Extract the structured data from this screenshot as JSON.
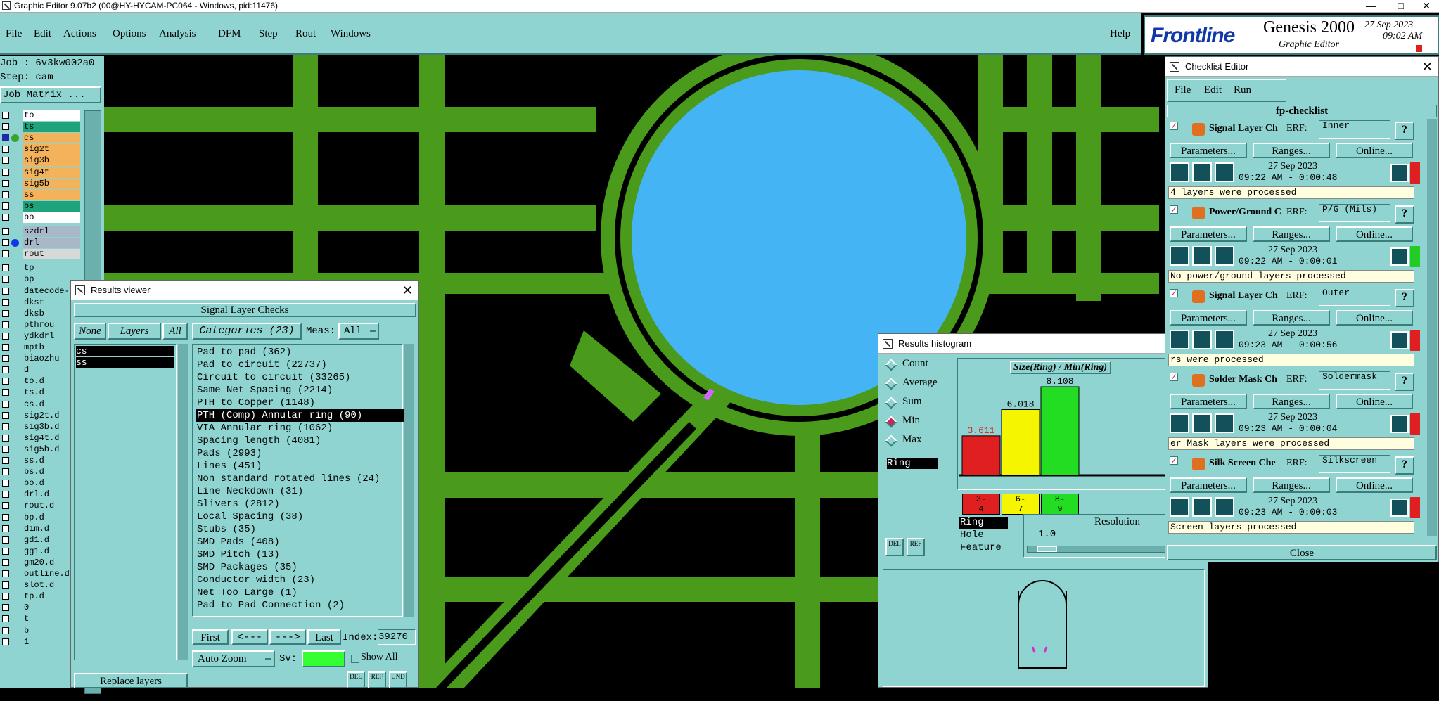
{
  "title_bar": {
    "text": "Graphic Editor 9.07b2 (00@HY-HYCAM-PC064 - Windows, pid:11476)"
  },
  "menu": [
    "File",
    "Edit",
    "Actions",
    "Options",
    "Analysis",
    "DFM",
    "Step",
    "Rout",
    "Windows"
  ],
  "help_label": "Help",
  "branding": {
    "logo": "Frontline",
    "product": "Genesis 2000",
    "subtitle": "Graphic Editor",
    "date": "27 Sep 2023",
    "time": "09:02 AM"
  },
  "job": {
    "job_label": "Job : 6v3kw002a0",
    "step_label": "Step: cam",
    "matrix_button": "Job Matrix ..."
  },
  "layers": [
    {
      "name": "to",
      "color": "#ffffff"
    },
    {
      "name": "ts",
      "color": "#1fa37a"
    },
    {
      "name": "cs",
      "color": "#f4b35a",
      "active": true
    },
    {
      "name": "sig2t",
      "color": "#f4b35a"
    },
    {
      "name": "sig3b",
      "color": "#f4b35a"
    },
    {
      "name": "sig4t",
      "color": "#f4b35a"
    },
    {
      "name": "sig5b",
      "color": "#f4b35a"
    },
    {
      "name": "ss",
      "color": "#f4b35a"
    },
    {
      "name": "bs",
      "color": "#1fa37a"
    },
    {
      "name": "bo",
      "color": "#ffffff"
    },
    {
      "name": "szdrl",
      "color": "#a8b8c8"
    },
    {
      "name": "drl",
      "color": "#a8b8c8",
      "active2": true
    },
    {
      "name": "rout",
      "color": "#d8d8d8"
    },
    {
      "name": "tp",
      "color": "#8fd4d0"
    },
    {
      "name": "bp",
      "color": "#8fd4d0"
    },
    {
      "name": "datecode-",
      "color": "#8fd4d0"
    },
    {
      "name": "dkst",
      "color": "#8fd4d0"
    },
    {
      "name": "dksb",
      "color": "#8fd4d0"
    },
    {
      "name": "pthrou",
      "color": "#8fd4d0"
    },
    {
      "name": "ydkdrl",
      "color": "#8fd4d0"
    },
    {
      "name": "mptb",
      "color": "#8fd4d0"
    },
    {
      "name": "biaozhu",
      "color": "#8fd4d0"
    },
    {
      "name": "d",
      "color": "#8fd4d0"
    },
    {
      "name": "to.d",
      "color": "#8fd4d0"
    },
    {
      "name": "ts.d",
      "color": "#8fd4d0"
    },
    {
      "name": "cs.d",
      "color": "#8fd4d0"
    },
    {
      "name": "sig2t.d",
      "color": "#8fd4d0"
    },
    {
      "name": "sig3b.d",
      "color": "#8fd4d0"
    },
    {
      "name": "sig4t.d",
      "color": "#8fd4d0"
    },
    {
      "name": "sig5b.d",
      "color": "#8fd4d0"
    },
    {
      "name": "ss.d",
      "color": "#8fd4d0"
    },
    {
      "name": "bs.d",
      "color": "#8fd4d0"
    },
    {
      "name": "bo.d",
      "color": "#8fd4d0"
    },
    {
      "name": "drl.d",
      "color": "#8fd4d0"
    },
    {
      "name": "rout.d",
      "color": "#8fd4d0"
    },
    {
      "name": "bp.d",
      "color": "#8fd4d0"
    },
    {
      "name": "dim.d",
      "color": "#8fd4d0"
    },
    {
      "name": "gd1.d",
      "color": "#8fd4d0"
    },
    {
      "name": "gg1.d",
      "color": "#8fd4d0"
    },
    {
      "name": "gm20.d",
      "color": "#8fd4d0"
    },
    {
      "name": "outline.d",
      "color": "#8fd4d0"
    },
    {
      "name": "slot.d",
      "color": "#8fd4d0"
    },
    {
      "name": "tp.d",
      "color": "#8fd4d0"
    },
    {
      "name": "0",
      "color": "#8fd4d0"
    },
    {
      "name": "t",
      "color": "#8fd4d0"
    },
    {
      "name": "b",
      "color": "#8fd4d0"
    },
    {
      "name": "1",
      "color": "#8fd4d0"
    }
  ],
  "results_viewer": {
    "title": "Results viewer",
    "header": "Signal Layer Checks",
    "none_btn": "None",
    "layers_btn": "Layers",
    "all_btn": "All",
    "categories_btn": "Categories (23)",
    "meas_label": "Meas:",
    "meas_value": "All",
    "layer_items": [
      "cs",
      "ss"
    ],
    "categories": [
      "Pad to pad (362)",
      "Pad to circuit (22737)",
      "Circuit to circuit (33265)",
      "Same Net Spacing (2214)",
      "PTH to Copper (1148)",
      "PTH (Comp) Annular ring (90)",
      "VIA Annular ring (1062)",
      "Spacing length (4081)",
      "Pads (2993)",
      "Lines (451)",
      "Non standard rotated lines (24)",
      "Line Neckdown (31)",
      "Slivers (2812)",
      "Local Spacing (38)",
      "Stubs (35)",
      "SMD Pads (408)",
      "SMD Pitch (13)",
      "SMD Packages (35)",
      "Conductor width (23)",
      "Net Too Large (1)",
      "Pad to Pad Connection (2)"
    ],
    "selected_category": 5,
    "first_btn": "First",
    "prev_btn": "<---",
    "next_btn": "--->",
    "last_btn": "Last",
    "index_label": "Index:",
    "index_value": "39270",
    "autozoom_btn": "Auto Zoom",
    "sv_label": "Sv:",
    "show_all_label": "Show All",
    "replace_layers_btn": "Replace layers",
    "del_label": "DEL",
    "ref_label": "REF",
    "und_label": "UND"
  },
  "histogram": {
    "title": "Results histogram",
    "options": [
      "Count",
      "Average",
      "Sum",
      "Min",
      "Max"
    ],
    "selected_option": "Min",
    "chart_title": "Size(Ring) / Min(Ring)",
    "list_item": "Ring",
    "fields": [
      "Ring",
      "Hole",
      "Feature"
    ],
    "resolution_label": "Resolution",
    "resolution_value": "1.0",
    "del_label": "DEL",
    "ref_label": "REF"
  },
  "chart_data": {
    "type": "bar",
    "title": "Size(Ring) / Min(Ring)",
    "categories": [
      "3-4",
      "6-7",
      "8-9"
    ],
    "values": [
      3.611,
      6.018,
      8.108
    ],
    "colors": [
      "#e02020",
      "#f5f500",
      "#22dd22"
    ],
    "ylim": [
      0,
      8.108
    ]
  },
  "checklist": {
    "title": "Checklist Editor",
    "menu": [
      "File",
      "Edit",
      "Run"
    ],
    "checklist_name": "fp-checklist",
    "params_btn": "Parameters...",
    "ranges_btn": "Ranges...",
    "online_btn": "Online...",
    "erf_label": "ERF:",
    "help_btn": "?",
    "close_btn": "Close",
    "items": [
      {
        "name": "Signal Layer Ch",
        "erf": "Inner",
        "date": "27 Sep 2023",
        "time": "09:22 AM - 0:00:48",
        "msg": "4 layers were processed",
        "status": "#e02020"
      },
      {
        "name": "Power/Ground C",
        "erf": "P/G (Mils)",
        "date": "27 Sep 2023",
        "time": "09:22 AM - 0:00:01",
        "msg": "No power/ground layers processed",
        "status": "#22cc22"
      },
      {
        "name": "Signal Layer Ch",
        "erf": "Outer",
        "date": "27 Sep 2023",
        "time": "09:23 AM - 0:00:56",
        "msg": "rs were processed",
        "status": "#e02020"
      },
      {
        "name": "Solder Mask Ch",
        "erf": "Soldermask",
        "date": "27 Sep 2023",
        "time": "09:23 AM - 0:00:04",
        "msg": "er Mask layers were processed",
        "status": "#e02020"
      },
      {
        "name": "Silk Screen Che",
        "erf": "Silkscreen",
        "date": "27 Sep 2023",
        "time": "09:23 AM - 0:00:03",
        "msg": "Screen layers processed",
        "status": "#e02020"
      }
    ]
  }
}
